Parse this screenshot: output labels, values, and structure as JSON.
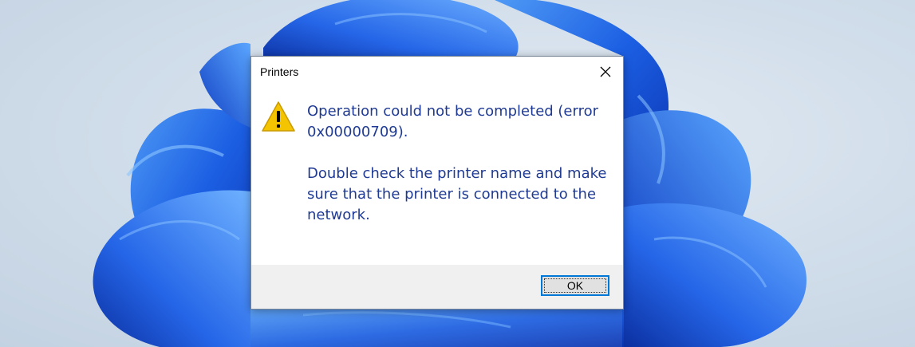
{
  "dialog": {
    "title": "Printers",
    "message_line1": "Operation could not be completed (error 0x00000709).",
    "message_line2": "Double check the printer name and make sure that the printer is connected to the network.",
    "ok_label": "OK",
    "icons": {
      "close": "close-icon",
      "warning": "warning-icon"
    }
  },
  "colors": {
    "message_text": "#1f3a93",
    "focus_border": "#0078d7",
    "wallpaper_bloom": "#1a5fe0"
  }
}
